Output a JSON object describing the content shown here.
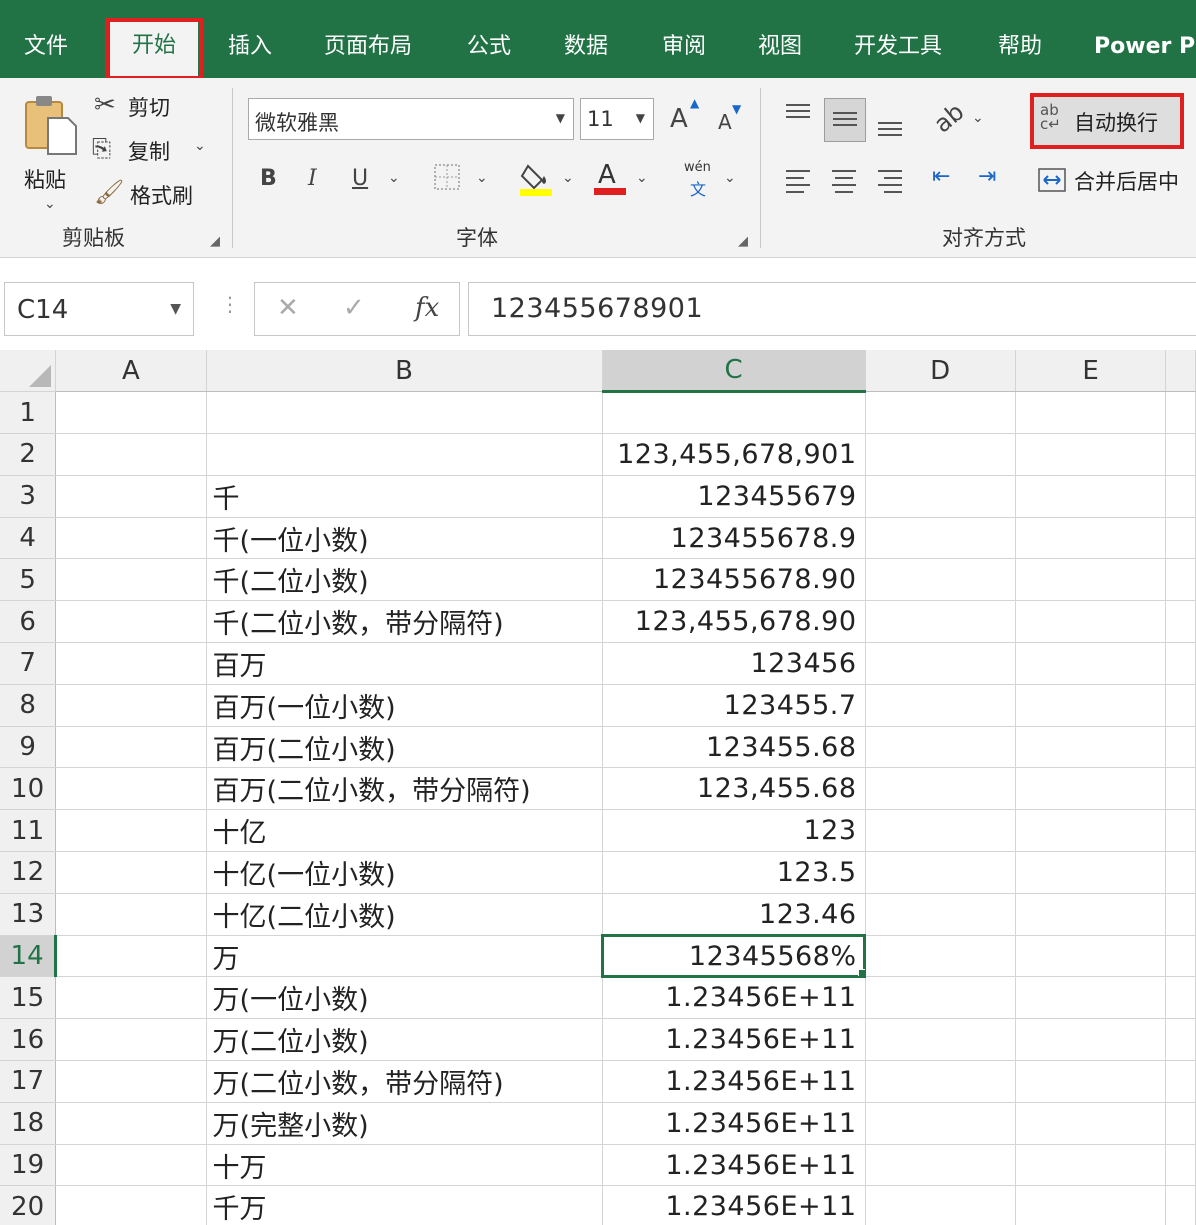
{
  "menu": {
    "items": [
      {
        "label": "文件"
      },
      {
        "label": "开始",
        "active": true
      },
      {
        "label": "插入"
      },
      {
        "label": "页面布局"
      },
      {
        "label": "公式"
      },
      {
        "label": "数据"
      },
      {
        "label": "审阅"
      },
      {
        "label": "视图"
      },
      {
        "label": "开发工具"
      },
      {
        "label": "帮助"
      },
      {
        "label": "Power Pi"
      }
    ]
  },
  "ribbon": {
    "clipboard": {
      "paste_label": "粘贴",
      "cut_label": "剪切",
      "copy_label": "复制",
      "format_painter_label": "格式刷",
      "group_label": "剪贴板"
    },
    "font": {
      "font_name": "微软雅黑",
      "font_size": "11",
      "increase_size": "A",
      "decrease_size": "A",
      "bold": "B",
      "italic": "I",
      "underline": "U",
      "font_color_glyph": "A",
      "phonetic_top": "wén",
      "phonetic_bottom": "文",
      "group_label": "字体"
    },
    "alignment": {
      "wrap_text_label": "自动换行",
      "merge_center_label": "合并后居中",
      "group_label": "对齐方式"
    },
    "colors": {
      "fill_color": "#ffff00",
      "font_color": "#e02020",
      "highlight": "#e02020",
      "accent": "#217346"
    }
  },
  "formula_bar": {
    "name_box": "C14",
    "cancel_glyph": "✕",
    "enter_glyph": "✓",
    "fx_label": "fx",
    "value": "123455678901"
  },
  "sheet": {
    "columns": [
      "A",
      "B",
      "C",
      "D",
      "E"
    ],
    "selected_column": "C",
    "selected_row": "14",
    "rows": [
      {
        "n": "1",
        "b": "",
        "c": ""
      },
      {
        "n": "2",
        "b": "",
        "c": "123,455,678,901"
      },
      {
        "n": "3",
        "b": "千",
        "c": "123455679"
      },
      {
        "n": "4",
        "b": "千(一位小数)",
        "c": "123455678.9"
      },
      {
        "n": "5",
        "b": "千(二位小数)",
        "c": "123455678.90"
      },
      {
        "n": "6",
        "b": "千(二位小数，带分隔符)",
        "c": "123,455,678.90"
      },
      {
        "n": "7",
        "b": "百万",
        "c": "123456"
      },
      {
        "n": "8",
        "b": "百万(一位小数)",
        "c": "123455.7"
      },
      {
        "n": "9",
        "b": "百万(二位小数)",
        "c": "123455.68"
      },
      {
        "n": "10",
        "b": "百万(二位小数，带分隔符)",
        "c": "123,455.68"
      },
      {
        "n": "11",
        "b": "十亿",
        "c": "123"
      },
      {
        "n": "12",
        "b": "十亿(一位小数)",
        "c": "123.5"
      },
      {
        "n": "13",
        "b": "十亿(二位小数)",
        "c": "123.46"
      },
      {
        "n": "14",
        "b": "万",
        "c": "12345568%"
      },
      {
        "n": "15",
        "b": "万(一位小数)",
        "c": "1.23456E+11"
      },
      {
        "n": "16",
        "b": "万(二位小数)",
        "c": "1.23456E+11"
      },
      {
        "n": "17",
        "b": "万(二位小数，带分隔符)",
        "c": "1.23456E+11"
      },
      {
        "n": "18",
        "b": "万(完整小数)",
        "c": "1.23456E+11"
      },
      {
        "n": "19",
        "b": "十万",
        "c": "1.23456E+11"
      },
      {
        "n": "20",
        "b": "千万",
        "c": "1.23456E+11"
      }
    ]
  }
}
